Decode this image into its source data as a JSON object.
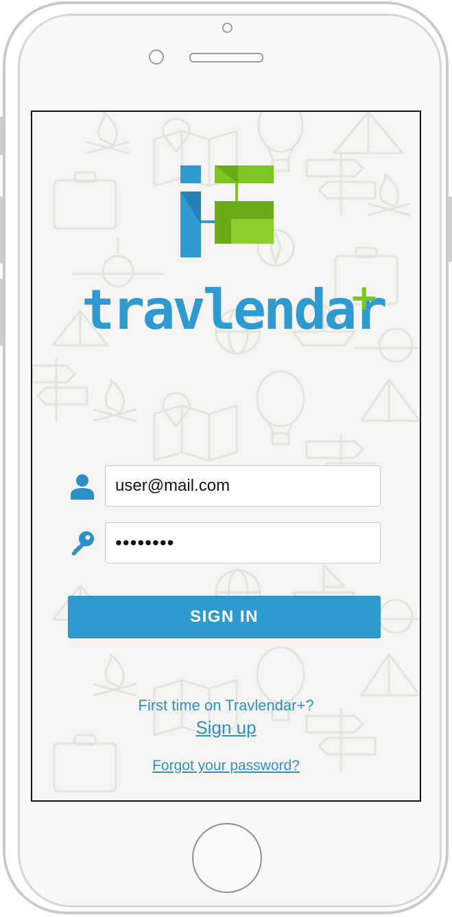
{
  "app": {
    "name": "travlendar",
    "name_suffix": "+"
  },
  "login": {
    "email_value": "user@mail.com",
    "password_value": "••••••••",
    "signin_label": "SIGN IN",
    "first_time_text": "First time on Travlendar+?",
    "signup_label": "Sign up",
    "forgot_label": "Forgot your password?"
  },
  "icons": {
    "user": "user-icon",
    "key": "key-icon"
  },
  "colors": {
    "brand_blue": "#2e9ad0",
    "brand_green": "#7ec424",
    "link_blue": "#2e8fc6",
    "background": "#f6f5f3"
  }
}
